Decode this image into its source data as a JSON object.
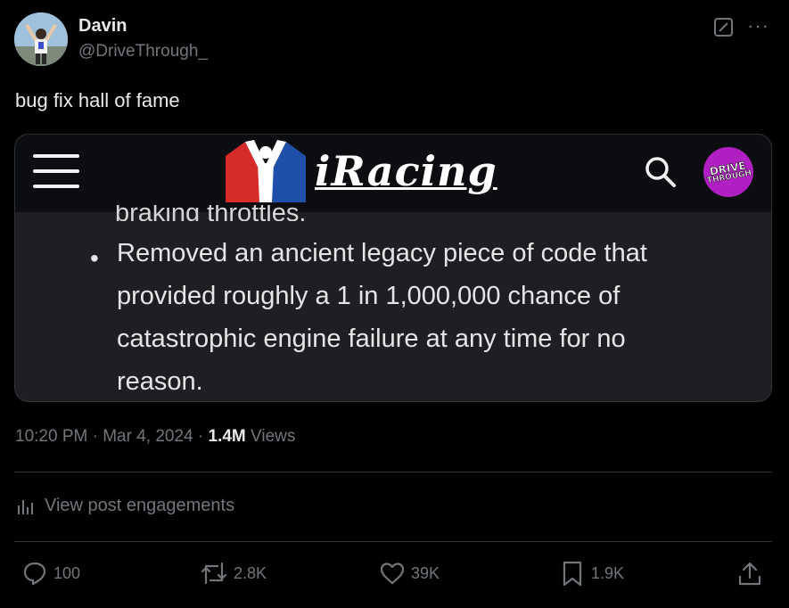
{
  "author": {
    "name": "Davin",
    "handle": "@DriveThrough_"
  },
  "post": {
    "text": "bug fix hall of fame"
  },
  "media": {
    "site_name": "iRacing",
    "badge_line1": "DRIVE",
    "badge_line2": "THROUGH",
    "cut_off_text": "braking throttles.",
    "bullet_lines": [
      "Removed an ancient legacy piece of code that",
      "provided roughly a 1 in 1,000,000 chance of",
      "catastrophic engine failure at any time for no",
      "reason."
    ]
  },
  "meta": {
    "time": "10:20 PM",
    "sep1": "·",
    "date": "Mar 4, 2024",
    "sep2": "·",
    "views_count": "1.4M",
    "views_label": "Views"
  },
  "engagements_link": "View post engagements",
  "actions": {
    "replies": "100",
    "reposts": "2.8K",
    "likes": "39K",
    "bookmarks": "1.9K"
  },
  "colors": {
    "background": "#000000",
    "text": "#e7e9ea",
    "muted": "#71767b",
    "border": "#2f3336",
    "iracing_red": "#d62b2b",
    "iracing_blue": "#1f4fa8",
    "drive_through_purple": "#b01fc1"
  },
  "icons": [
    "grok-icon",
    "more-icon",
    "hamburger-icon",
    "search-icon",
    "analytics-icon",
    "reply-icon",
    "repost-icon",
    "like-icon",
    "bookmark-icon",
    "share-icon"
  ]
}
